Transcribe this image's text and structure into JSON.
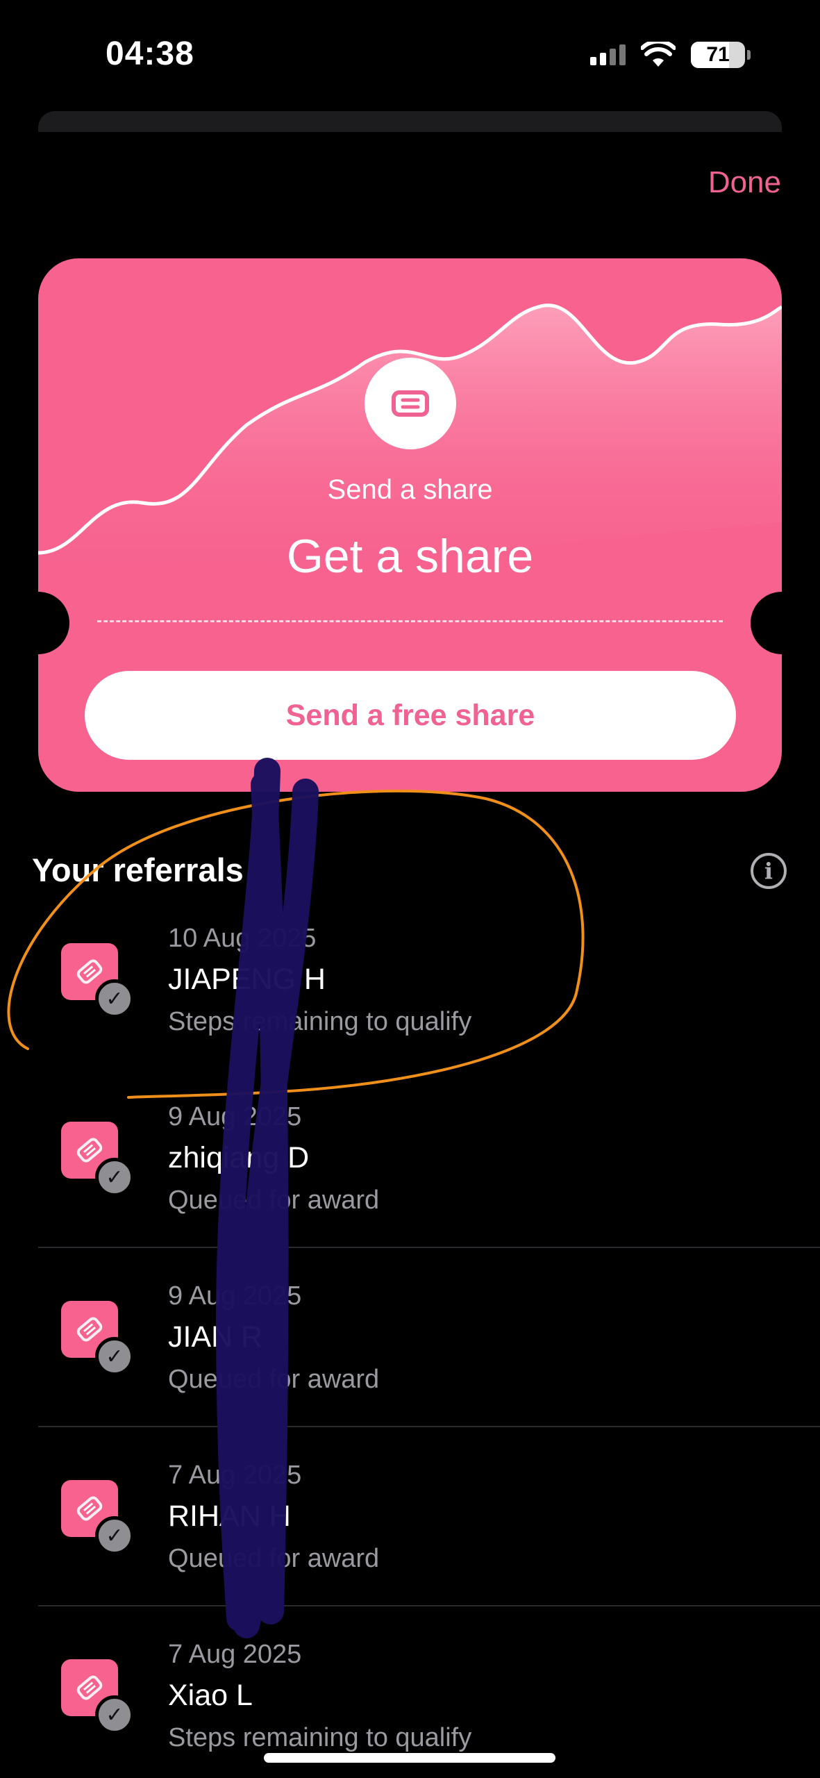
{
  "status_bar": {
    "time": "04:38",
    "battery": "71"
  },
  "header": {
    "done_label": "Done"
  },
  "promo_card": {
    "subtitle": "Send a share",
    "title": "Get a share",
    "button_label": "Send a free share",
    "color": "#f7628f"
  },
  "referrals": {
    "title": "Your referrals",
    "info_icon": "info-icon",
    "items": [
      {
        "date": "10 Aug 2025",
        "name": "JIAPENG H",
        "status": "Steps remaining to qualify"
      },
      {
        "date": "9 Aug 2025",
        "name": "zhiqiang D",
        "status": "Queued for award"
      },
      {
        "date": "9 Aug 2025",
        "name": "JIAN R",
        "status": "Queued for award"
      },
      {
        "date": "7 Aug 2025",
        "name": "RIHAN H",
        "status": "Queued for award"
      },
      {
        "date": "7 Aug 2025",
        "name": "Xiao L",
        "status": "Steps remaining to qualify"
      }
    ]
  },
  "colors": {
    "accent": "#f06292",
    "background": "#000000",
    "annotation_circle": "#f0901a",
    "annotation_scribble": "#1a0f5e"
  }
}
